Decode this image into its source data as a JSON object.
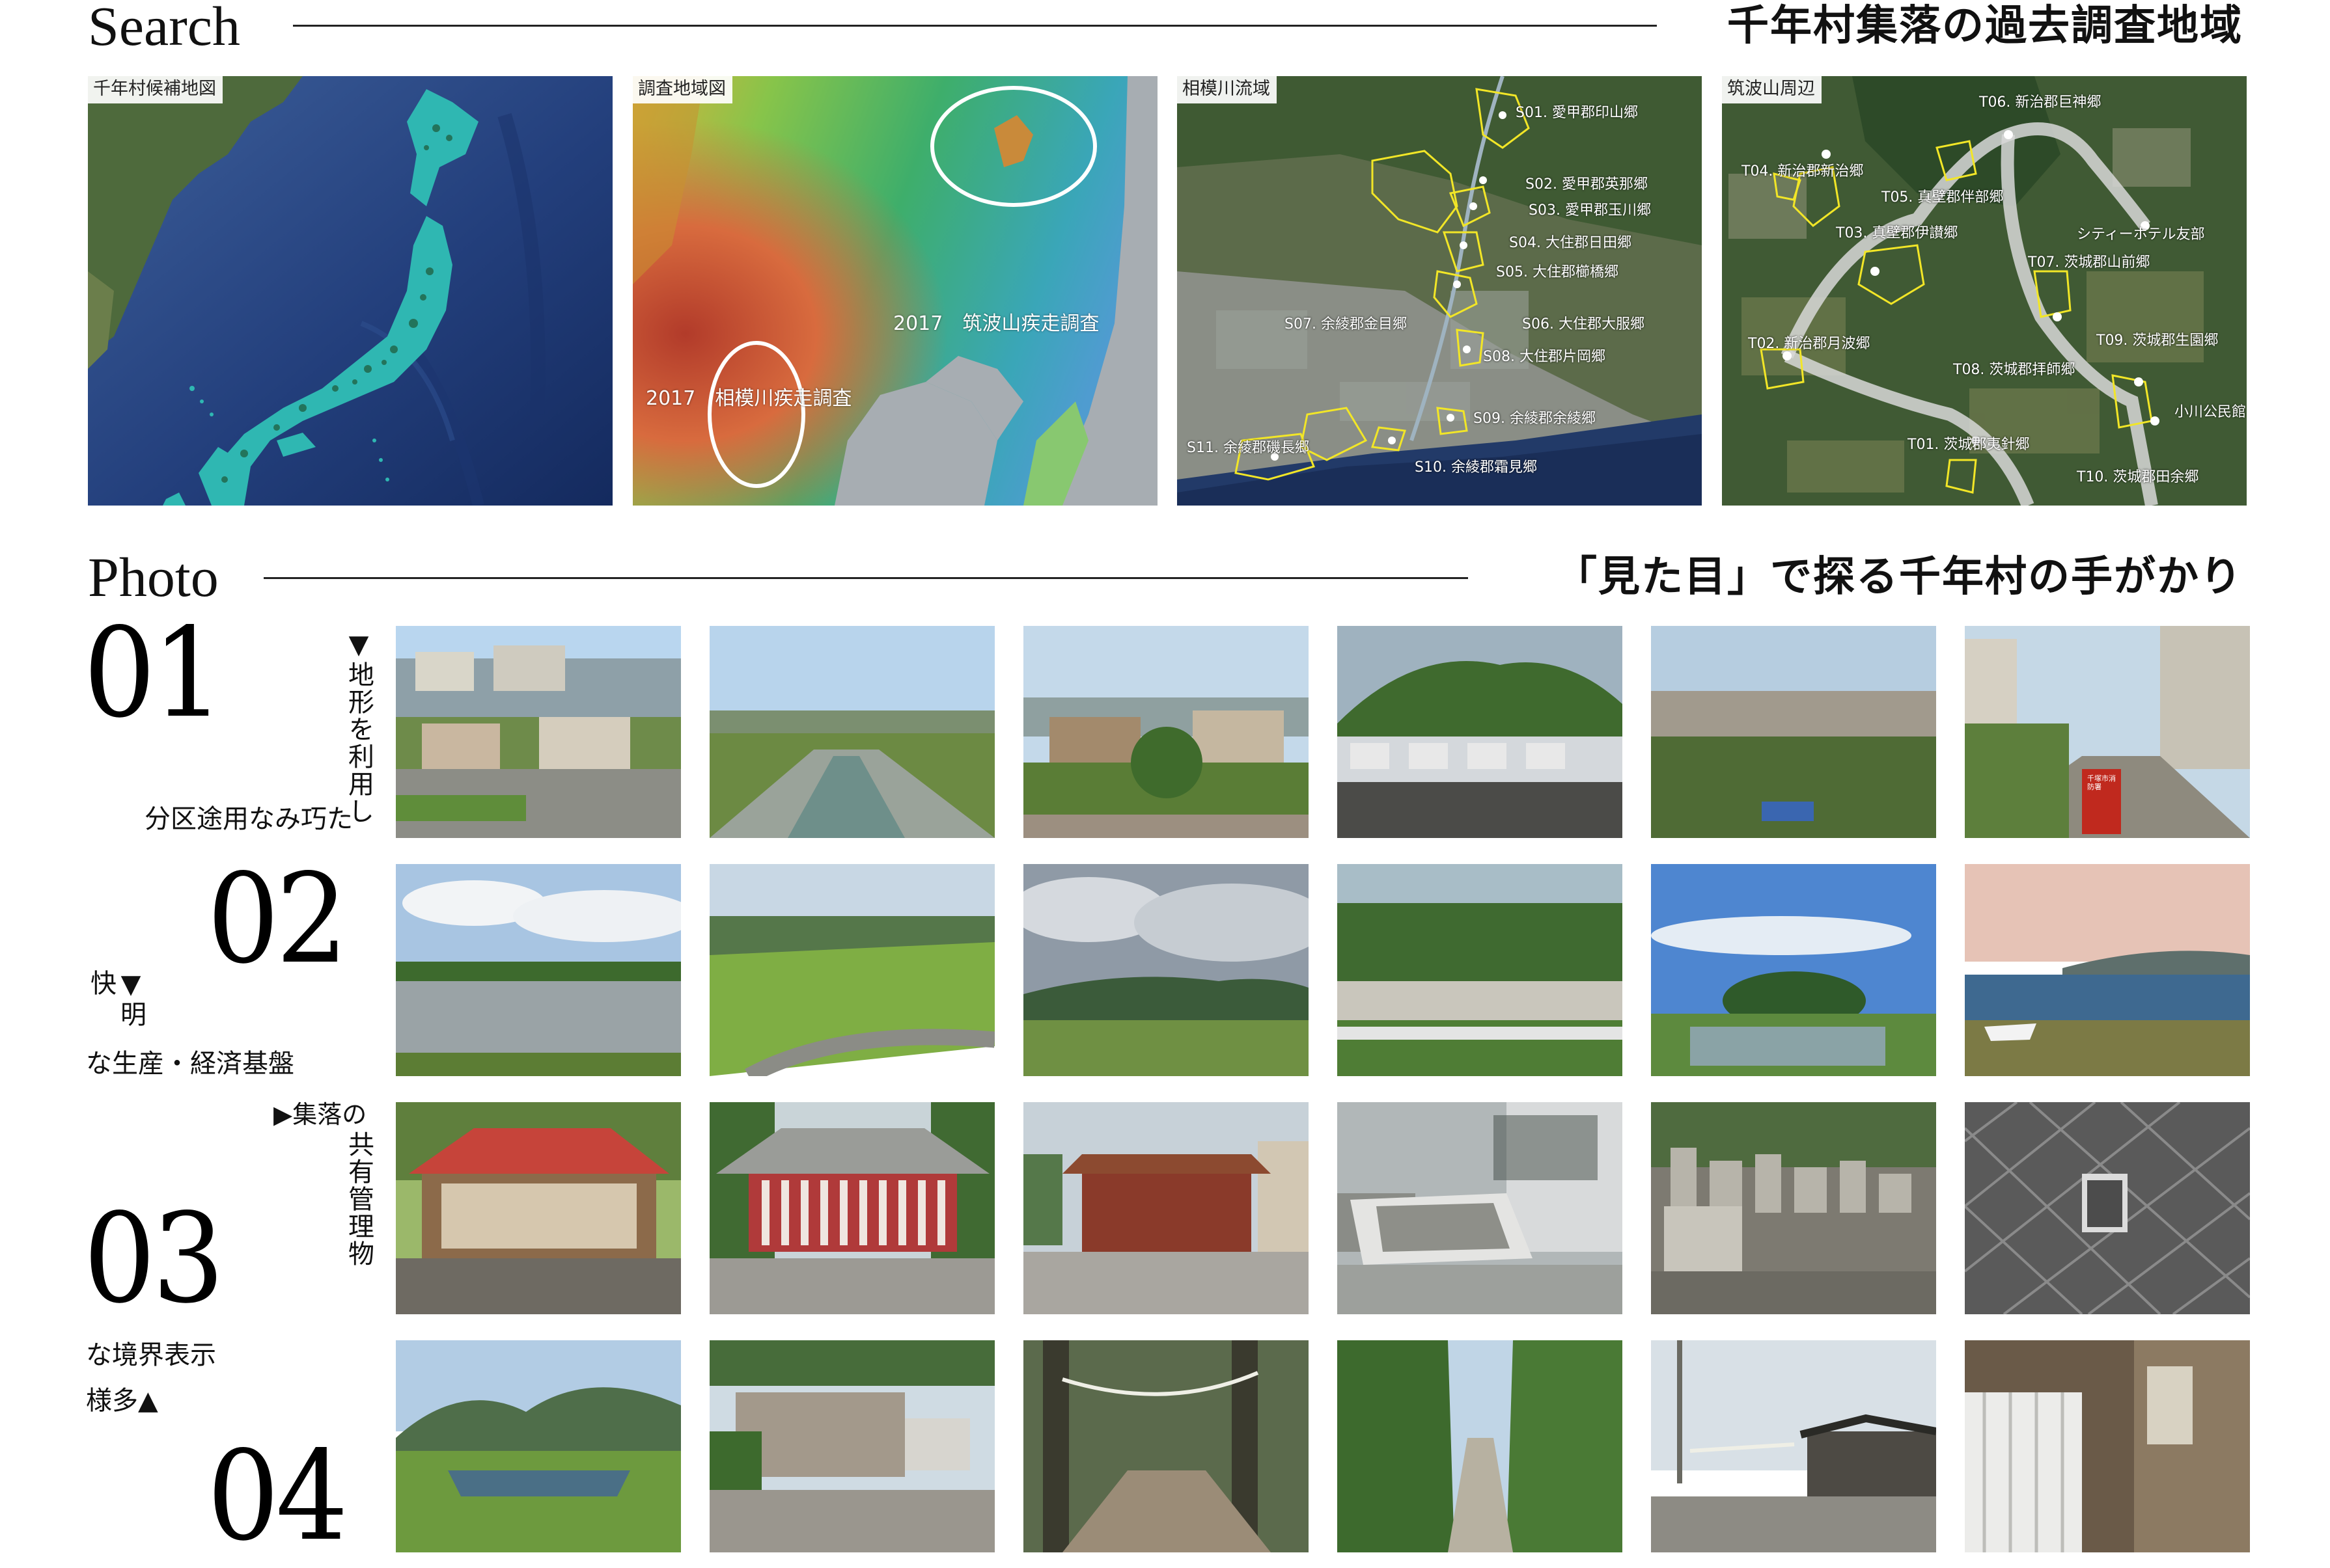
{
  "search": {
    "title_en": "Search",
    "title_ja": "千年村集落の過去調査地域",
    "maps": [
      {
        "label": "千年村候補地図"
      },
      {
        "label": "調査地域図",
        "annotations": [
          "2017　筑波山疾走調査",
          "2017　相模川疾走調査"
        ]
      },
      {
        "label": "相模川流域",
        "sites": [
          "S01. 愛甲郡印山郷",
          "S02. 愛甲郡英那郷",
          "S03. 愛甲郡玉川郷",
          "S04. 大住郡日田郷",
          "S05. 大住郡櫛橋郷",
          "S06. 大住郡大服郷",
          "S07. 余綾郡金目郷",
          "S08. 大住郡片岡郷",
          "S09. 余綾郡余綾郷",
          "S10. 余綾郡霜見郷",
          "S11. 余綾郡磯長郷"
        ]
      },
      {
        "label": "筑波山周辺",
        "sites": [
          "T06. 新治郡巨神郷",
          "T04. 新治郡新治郷",
          "T05. 真壁郡伴部郷",
          "シティーホテル友部",
          "T03. 真壁郡伊讃郷",
          "T07. 茨城郡山前郷",
          "T09. 茨城郡生園郷",
          "T02. 新治郡月波郷",
          "T08. 茨城郡拝師郷",
          "小川公民館",
          "T01. 茨城郡夷針郷",
          "T10. 茨城郡田余郷"
        ]
      }
    ]
  },
  "photo": {
    "title_en": "Photo",
    "title_ja": "「見た目」で探る千年村の手がかり",
    "rows": [
      {
        "number": "01",
        "caption_vertical": "▼地形を利用し",
        "caption_horizontal": "分区途用なみ巧た"
      },
      {
        "number": "02",
        "caption_vertical": "▼明快",
        "caption_horizontal": "な生産・経済基盤"
      },
      {
        "number": "03",
        "caption_vertical": "▶集落の共有管理物",
        "caption_horizontal": ""
      },
      {
        "number": "04",
        "caption_vertical": "",
        "caption_horizontal_1": "な境界表示",
        "caption_horizontal_2": "様多▲"
      }
    ],
    "photo_text": {
      "fire_station_sign": "千塚市消防署"
    }
  }
}
